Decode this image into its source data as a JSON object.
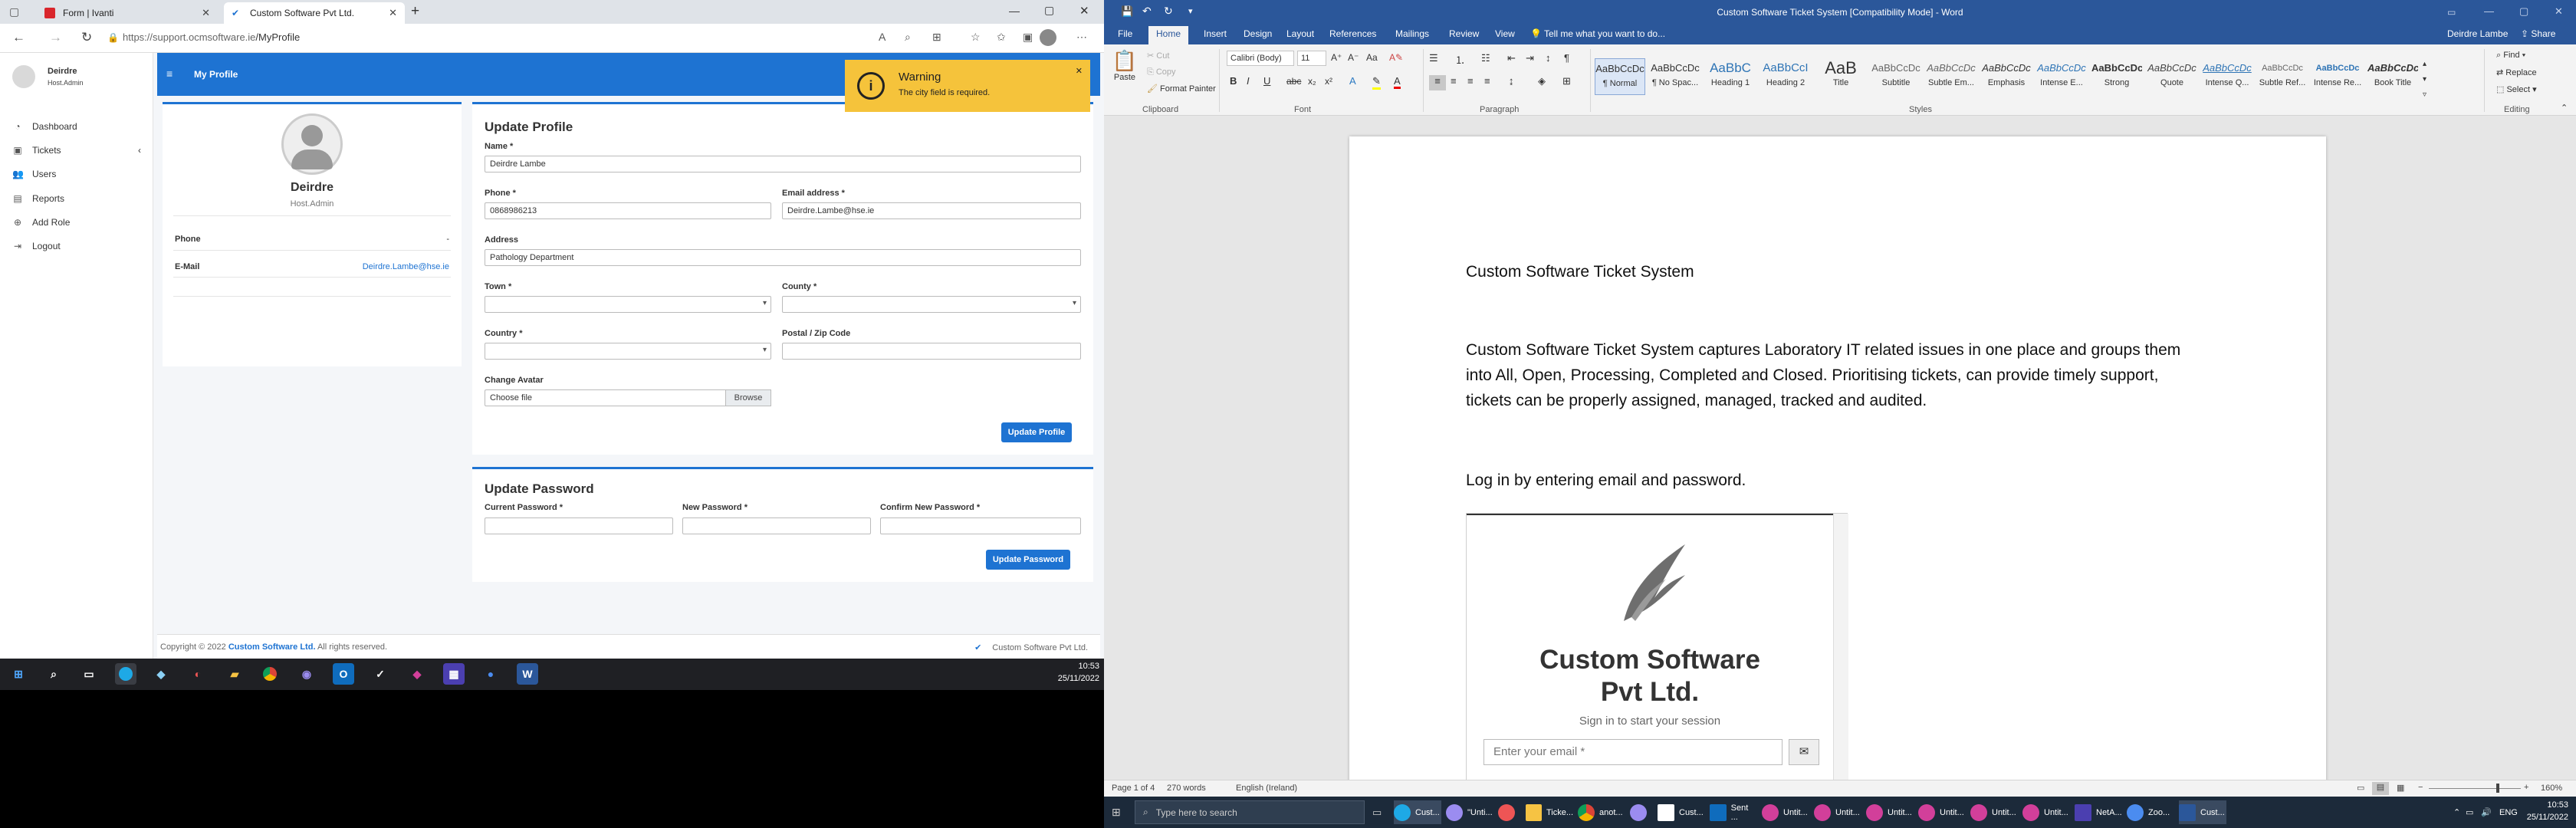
{
  "left_browser": {
    "tabs": [
      {
        "title": "Form | Ivanti"
      },
      {
        "title": "Custom Software Pvt Ltd."
      }
    ],
    "new_tab_symbol": "+",
    "url_host": "https://support.ocmsoftware.ie",
    "url_path": "/MyProfile",
    "app": {
      "sidebar": {
        "user_name": "Deirdre",
        "user_role": "Host.Admin",
        "items": [
          {
            "label": "Dashboard",
            "icon": "dashboard-icon"
          },
          {
            "label": "Tickets",
            "icon": "ticket-icon"
          },
          {
            "label": "Users",
            "icon": "users-icon"
          },
          {
            "label": "Reports",
            "icon": "reports-icon"
          },
          {
            "label": "Add Role",
            "icon": "add-role-icon"
          },
          {
            "label": "Logout",
            "icon": "logout-icon"
          }
        ]
      },
      "topnav": {
        "title": "My Profile"
      },
      "profile_card": {
        "name": "Deirdre",
        "role": "Host.Admin",
        "phone_label": "Phone",
        "phone_value": "-",
        "email_label": "E-Mail",
        "email_value": "Deirdre.Lambe@hse.ie"
      },
      "update_profile": {
        "title": "Update Profile",
        "name_label": "Name *",
        "name_value": "Deirdre Lambe",
        "phone_label": "Phone *",
        "phone_value": "0868986213",
        "email_label": "Email address *",
        "email_value": "Deirdre.Lambe@hse.ie",
        "address_label": "Address",
        "address_value": "Pathology Department",
        "town_label": "Town *",
        "county_label": "County *",
        "country_label": "Country *",
        "postal_label": "Postal / Zip Code",
        "avatar_label": "Change Avatar",
        "avatar_placeholder": "Choose file",
        "browse_label": "Browse",
        "submit_label": "Update Profile"
      },
      "update_password": {
        "title": "Update Password",
        "current_label": "Current Password *",
        "new_label": "New Password *",
        "confirm_label": "Confirm New Password *",
        "submit_label": "Update Password"
      },
      "warning": {
        "title": "Warning",
        "message": "The city field is required."
      },
      "footer": {
        "copyright_prefix": "Copyright © 2022 ",
        "company": "Custom Software Ltd.",
        "copyright_suffix": " All rights reserved.",
        "brand": "Custom Software Pvt Ltd."
      }
    },
    "taskbar": {
      "time": "10:53",
      "date": "25/11/2022"
    }
  },
  "word": {
    "window_title": "Custom Software Ticket System [Compatibility Mode] - Word",
    "user": "Deirdre Lambe",
    "share": "Share",
    "tabs": [
      "File",
      "Home",
      "Insert",
      "Design",
      "Layout",
      "References",
      "Mailings",
      "Review",
      "View"
    ],
    "tell_me": "Tell me what you want to do...",
    "clipboard": {
      "paste": "Paste",
      "cut": "Cut",
      "copy": "Copy",
      "format_painter": "Format Painter",
      "label": "Clipboard"
    },
    "font": {
      "name": "Calibri (Body)",
      "size": "11",
      "label": "Font"
    },
    "paragraph": {
      "label": "Paragraph"
    },
    "styles": {
      "label": "Styles",
      "items": [
        {
          "preview": "AaBbCcDc",
          "name": "¶ Normal"
        },
        {
          "preview": "AaBbCcDc",
          "name": "¶ No Spac..."
        },
        {
          "preview": "AaBbC",
          "name": "Heading 1"
        },
        {
          "preview": "AaBbCcI",
          "name": "Heading 2"
        },
        {
          "preview": "AaB",
          "name": "Title"
        },
        {
          "preview": "AaBbCcDc",
          "name": "Subtitle"
        },
        {
          "preview": "AaBbCcDc",
          "name": "Subtle Em..."
        },
        {
          "preview": "AaBbCcDc",
          "name": "Emphasis"
        },
        {
          "preview": "AaBbCcDc",
          "name": "Intense E..."
        },
        {
          "preview": "AaBbCcDc",
          "name": "Strong"
        },
        {
          "preview": "AaBbCcDc",
          "name": "Quote"
        },
        {
          "preview": "AaBbCcDc",
          "name": "Intense Q..."
        },
        {
          "preview": "AaBbCcDc",
          "name": "Subtle Ref..."
        },
        {
          "preview": "AaBbCcDc",
          "name": "Intense Re..."
        },
        {
          "preview": "AaBbCcDc",
          "name": "Book Title"
        }
      ]
    },
    "editing": {
      "find": "Find",
      "replace": "Replace",
      "select": "Select",
      "label": "Editing"
    },
    "document": {
      "heading": "Custom Software Ticket System",
      "para1_l1": "Custom Software Ticket System captures Laboratory IT related issues in one place and groups them",
      "para1_l2": "into All, Open, Processing, Completed and Closed.  Prioritising tickets, can provide timely support,",
      "para1_l3": "tickets can be properly assigned, managed, tracked and audited.",
      "para2": "Log in by entering email and password.",
      "embedded_logo_l1": "Custom Software",
      "embedded_logo_l2": "Pvt Ltd.",
      "embedded_sub": "Sign in to start your session",
      "embedded_placeholder": "Enter your email *"
    },
    "status": {
      "page": "Page 1 of 4",
      "words": "270 words",
      "lang": "English (Ireland)",
      "zoom": "160%"
    }
  },
  "right_taskbar": {
    "search_placeholder": "Type here to search",
    "items": [
      "Cust...",
      "\"Unti...",
      "",
      "Ticke...",
      "anot...",
      "",
      "Cust...",
      "Sent ...",
      "Untit...",
      "Untit...",
      "Untit...",
      "Untit...",
      "Untit...",
      "Untit...",
      "NetA...",
      "Zoo...",
      "Cust..."
    ],
    "lang": "ENG",
    "time": "10:53",
    "date": "25/11/2022"
  }
}
